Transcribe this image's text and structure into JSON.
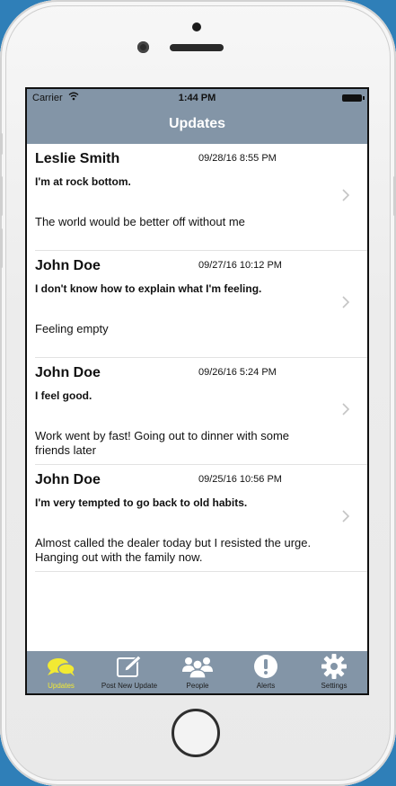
{
  "status_bar": {
    "carrier": "Carrier",
    "time": "1:44 PM"
  },
  "nav": {
    "title": "Updates"
  },
  "updates": [
    {
      "name": "Leslie Smith",
      "date": "09/28/16 8:55 PM",
      "headline": "I'm at rock bottom.",
      "body": "The world would be better off without me"
    },
    {
      "name": "John Doe",
      "date": "09/27/16 10:12 PM",
      "headline": "I don't know how to explain what I'm feeling.",
      "body": "Feeling empty"
    },
    {
      "name": "John Doe",
      "date": "09/26/16 5:24 PM",
      "headline": "I feel good.",
      "body": "Work went by fast! Going out to dinner with some friends later"
    },
    {
      "name": "John Doe",
      "date": "09/25/16 10:56 PM",
      "headline": "I'm very tempted to go back to old habits.",
      "body": "Almost called the dealer today but I resisted the urge. Hanging out with the family now."
    }
  ],
  "tabs": [
    {
      "label": "Updates",
      "icon": "speech-bubbles-icon",
      "active": true
    },
    {
      "label": "Post New Update",
      "icon": "compose-icon",
      "active": false
    },
    {
      "label": "People",
      "icon": "people-icon",
      "active": false
    },
    {
      "label": "Alerts",
      "icon": "alert-icon",
      "active": false
    },
    {
      "label": "Settings",
      "icon": "gear-icon",
      "active": false
    }
  ],
  "colors": {
    "bar": "#8395a7",
    "active_tab": "#f2ea33",
    "background": "#2f7fb8"
  }
}
